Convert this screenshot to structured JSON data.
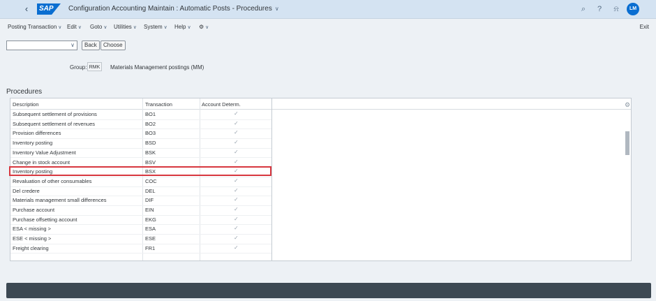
{
  "header": {
    "logo": "SAP",
    "title": "Configuration Accounting Maintain : Automatic Posts - Procedures",
    "avatar_initials": "LM"
  },
  "menu": {
    "items": [
      "Posting Transaction",
      "Edit",
      "Goto",
      "Utilities",
      "System",
      "Help"
    ],
    "exit": "Exit"
  },
  "toolbar": {
    "command_value": "",
    "back": "Back",
    "choose": "Choose"
  },
  "group": {
    "label": "Group:",
    "value": "RMK",
    "description": "Materials Management postings (MM)"
  },
  "procedures": {
    "title": "Procedures",
    "columns": [
      "Description",
      "Transaction",
      "Account Determ."
    ],
    "rows": [
      {
        "description": "Subsequent settlement of provisions",
        "transaction": "BO1",
        "checked": true
      },
      {
        "description": "Subsequent settlement of revenues",
        "transaction": "BO2",
        "checked": true
      },
      {
        "description": "Provision differences",
        "transaction": "BO3",
        "checked": true
      },
      {
        "description": "Inventory posting",
        "transaction": "BSD",
        "checked": true
      },
      {
        "description": "Inventory Value Adjustment",
        "transaction": "BSK",
        "checked": true
      },
      {
        "description": "Change in stock account",
        "transaction": "BSV",
        "checked": true
      },
      {
        "description": "Inventory posting",
        "transaction": "BSX",
        "checked": true,
        "highlighted": true
      },
      {
        "description": "Revaluation of other consumables",
        "transaction": "COC",
        "checked": true
      },
      {
        "description": "Del credere",
        "transaction": "DEL",
        "checked": true
      },
      {
        "description": "Materials management small differences",
        "transaction": "DIF",
        "checked": true
      },
      {
        "description": "Purchase account",
        "transaction": "EIN",
        "checked": true
      },
      {
        "description": "Purchase offsetting account",
        "transaction": "EKG",
        "checked": true
      },
      {
        "description": "ESA < missing >",
        "transaction": "ESA",
        "checked": true
      },
      {
        "description": "ESE < missing >",
        "transaction": "ESE",
        "checked": true
      },
      {
        "description": "Freight clearing",
        "transaction": "FR1",
        "checked": true
      }
    ]
  },
  "colors": {
    "shell": "#d4e3f2",
    "brand": "#0a6ed1",
    "highlight": "#d7373f",
    "footer": "#3d4953"
  }
}
